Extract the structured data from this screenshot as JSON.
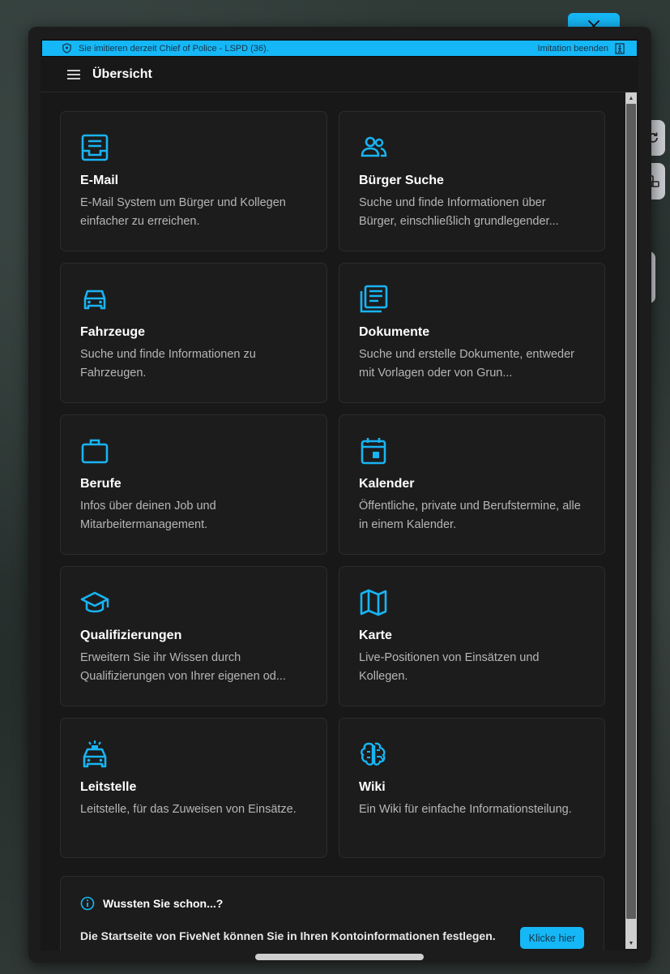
{
  "impersonation": {
    "text": "Sie imitieren derzeit Chief of Police - LSPD (36).",
    "end_label": "Imitation beenden"
  },
  "header": {
    "title": "Übersicht"
  },
  "cards": [
    {
      "icon": "inbox-icon",
      "title": "E-Mail",
      "desc": "E-Mail System um Bürger und Kollegen einfacher zu erreichen."
    },
    {
      "icon": "people-icon",
      "title": "Bürger Suche",
      "desc": "Suche und finde Informationen über Bürger, einschließlich grundlegender..."
    },
    {
      "icon": "car-icon",
      "title": "Fahrzeuge",
      "desc": "Suche und finde Informationen zu Fahrzeugen."
    },
    {
      "icon": "documents-icon",
      "title": "Dokumente",
      "desc": "Suche und erstelle Dokumente, entweder mit Vorlagen oder von Grun..."
    },
    {
      "icon": "briefcase-icon",
      "title": "Berufe",
      "desc": "Infos über deinen Job und Mitarbeitermanagement."
    },
    {
      "icon": "calendar-icon",
      "title": "Kalender",
      "desc": "Öffentliche, private und Berufstermine, alle in einem Kalender."
    },
    {
      "icon": "graduation-cap-icon",
      "title": "Qualifizierungen",
      "desc": "Erweitern Sie ihr Wissen durch Qualifizierungen von Ihrer eigenen od..."
    },
    {
      "icon": "map-icon",
      "title": "Karte",
      "desc": "Live-Positionen von Einsätzen und Kollegen."
    },
    {
      "icon": "police-car-icon",
      "title": "Leitstelle",
      "desc": "Leitstelle, für das Zuweisen von Einsätze."
    },
    {
      "icon": "brain-icon",
      "title": "Wiki",
      "desc": "Ein Wiki für einfache Informationsteilung."
    }
  ],
  "tip": {
    "title": "Wussten Sie schon...?",
    "body": "Die Startseite von FiveNet können Sie in Ihren Kontoinformationen festlegen.",
    "button": "Klicke hier"
  },
  "colors": {
    "accent": "#16b7f6",
    "card_bg": "#1c1c1c",
    "page_bg": "#181818"
  }
}
